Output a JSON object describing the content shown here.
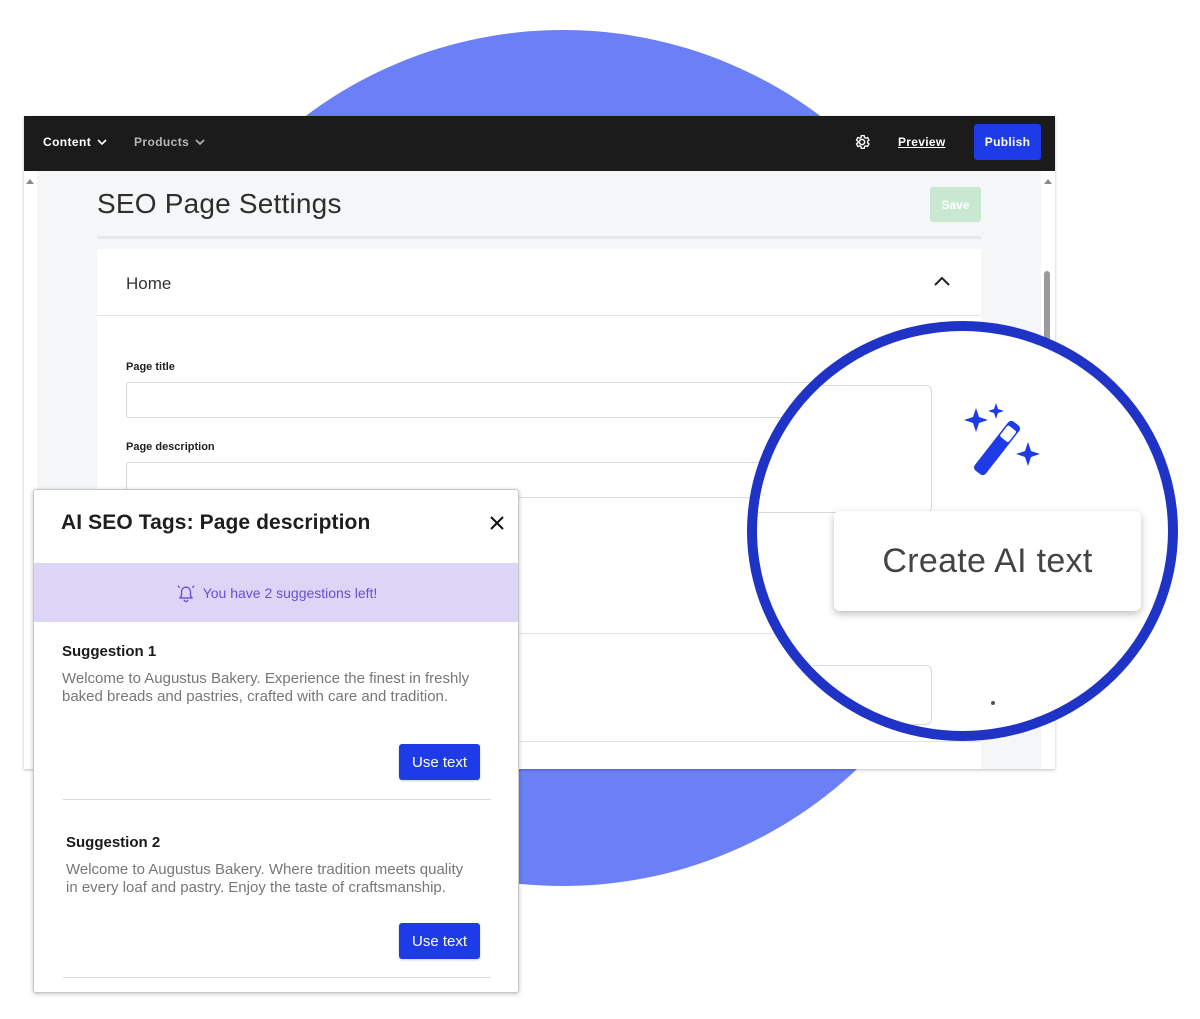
{
  "nav": {
    "items": [
      {
        "label": "Content"
      },
      {
        "label": "Products"
      }
    ],
    "preview_label": "Preview",
    "publish_label": "Publish"
  },
  "page": {
    "title": "SEO Page Settings",
    "save_label": "Save",
    "section_label": "Home",
    "fields": {
      "page_title_label": "Page title",
      "page_description_label": "Page description"
    }
  },
  "ai_panel": {
    "title": "AI SEO Tags: Page description",
    "notice": "You have 2 suggestions left!",
    "suggestions": [
      {
        "title": "Suggestion 1",
        "text": "Welcome to Augustus Bakery. Experience the finest in freshly baked breads and pastries, crafted with care and tradition.",
        "button": "Use text"
      },
      {
        "title": "Suggestion 2",
        "text": "Welcome to Augustus Bakery. Where tradition meets quality in every loaf and pastry. Enjoy the taste of craftsmanship.",
        "button": "Use text"
      }
    ]
  },
  "magnifier": {
    "tooltip": "Create AI text",
    "icon": "magic-wand-icon"
  },
  "colors": {
    "accent": "#1d3be6",
    "topbar": "#1b1b1b",
    "background_blob": "#6b7ff6",
    "magnifier_ring": "#1f34c7",
    "notice_bg": "#ddd5f6",
    "notice_text": "#6b4dd1",
    "save_disabled": "#c9e8d1"
  }
}
